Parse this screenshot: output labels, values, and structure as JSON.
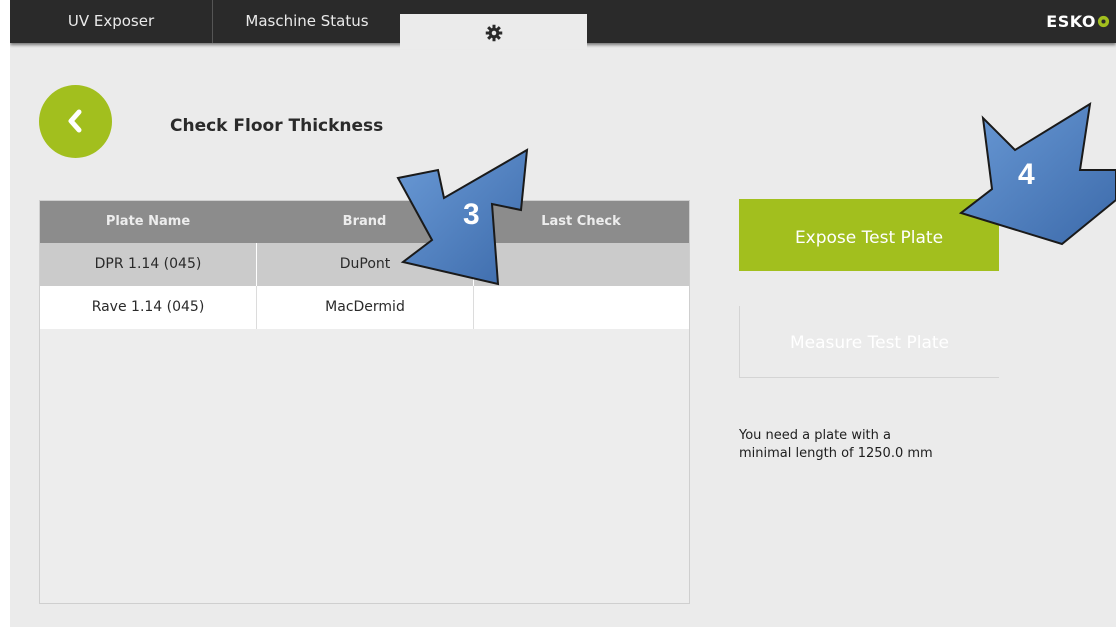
{
  "tabs": {
    "uv_exposer": "UV Exposer",
    "machine_status": "Maschine Status",
    "settings_icon": "gear-icon"
  },
  "brand": {
    "logo_text": "ESKO",
    "logo_mark_color": "#a2bf1e"
  },
  "header": {
    "back_icon": "chevron-left-icon",
    "title": "Check Floor Thickness"
  },
  "table": {
    "columns": [
      "Plate Name",
      "Brand",
      "Last Check"
    ],
    "rows": [
      {
        "plate_name": "DPR 1.14 (045)",
        "brand": "DuPont",
        "last_check": ""
      },
      {
        "plate_name": "Rave 1.14 (045)",
        "brand": "MacDermid",
        "last_check": ""
      }
    ]
  },
  "actions": {
    "expose_label": "Expose Test Plate",
    "measure_label": "Measure Test Plate"
  },
  "note": {
    "line1": "You need a plate with a",
    "line2": "minimal length of 1250.0 mm"
  },
  "annotations": {
    "arrow_3": "3",
    "arrow_4": "4"
  },
  "colors": {
    "accent": "#a2bf1e",
    "topbar": "#2a2a2a",
    "arrow": "#4a78b8"
  }
}
